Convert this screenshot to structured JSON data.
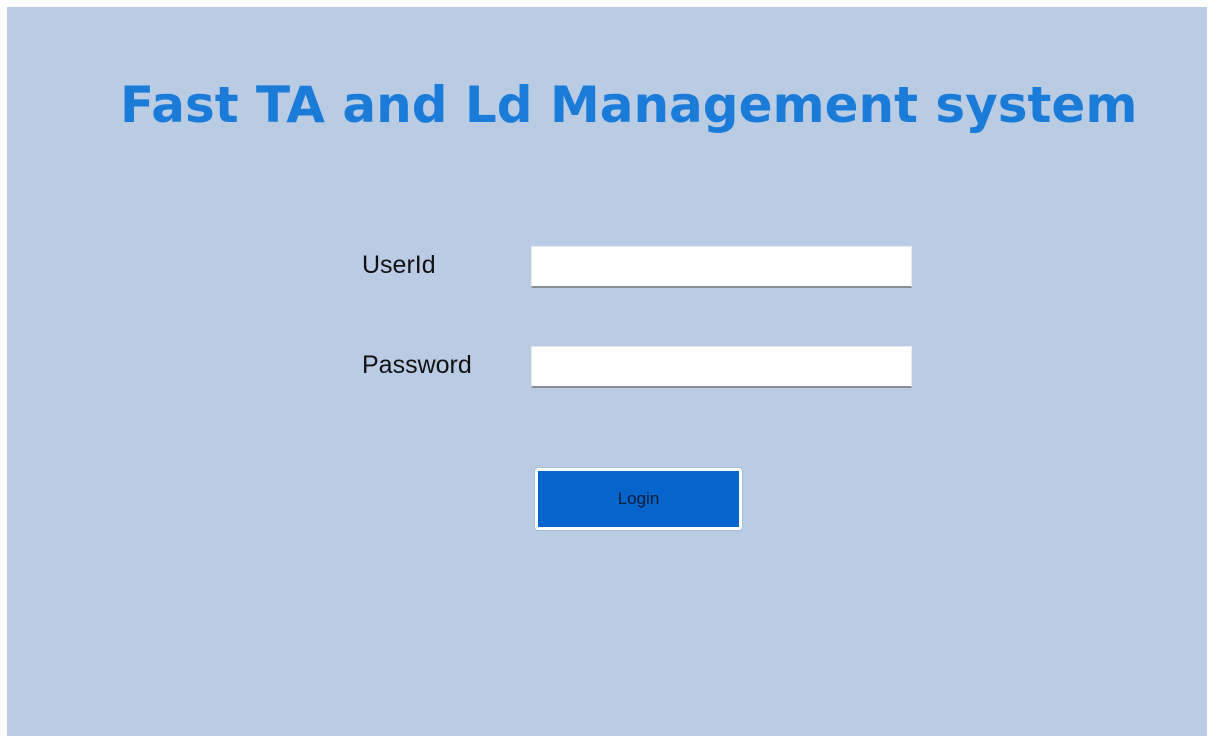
{
  "page": {
    "title": "Fast TA and Ld Management system"
  },
  "login_form": {
    "userid_label": "UserId",
    "userid_value": "",
    "password_label": "Password",
    "password_value": "",
    "login_button_label": "Login"
  },
  "colors": {
    "background": "#b9cce4",
    "title": "#1b7bd8",
    "button": "#0565cc"
  }
}
